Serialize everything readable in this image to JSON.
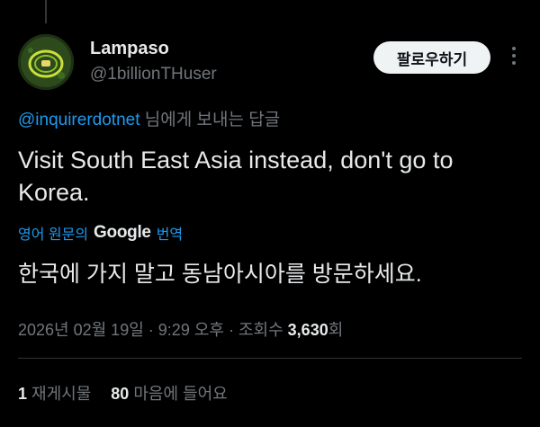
{
  "user": {
    "display_name": "Lampaso",
    "handle": "@1billionTHuser"
  },
  "follow_label": "팔로우하기",
  "reply": {
    "mention": "@inquirerdotnet",
    "suffix": " 님에게 보내는 답글"
  },
  "tweet_text": "Visit South East Asia instead, don't go to Korea.",
  "translation": {
    "prefix": "영어 원문의",
    "brand": "Google",
    "suffix": "번역",
    "text": "한국에 가지 말고 동남아시아를 방문하세요."
  },
  "meta": {
    "date": "2026년 02월 19일",
    "time": "9:29 오후",
    "views_label": "조회수",
    "views_count": "3,630",
    "views_suffix": "회"
  },
  "stats": {
    "reposts_count": "1",
    "reposts_label": "재게시물",
    "likes_count": "80",
    "likes_label": "마음에 들어요"
  },
  "icons": {
    "more": "more-icon",
    "avatar": "avatar"
  }
}
